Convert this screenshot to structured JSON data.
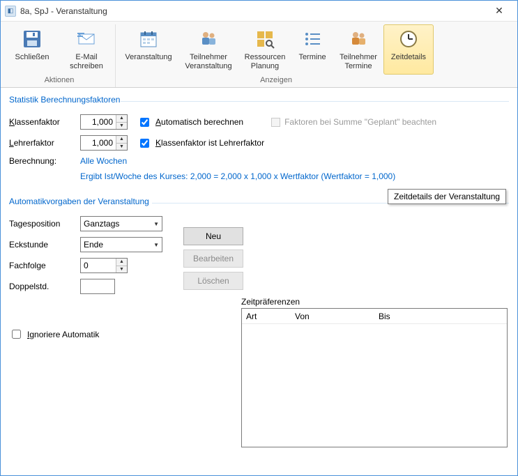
{
  "window": {
    "title": "8a, SpJ - Veranstaltung"
  },
  "ribbon": {
    "group1_label": "Aktionen",
    "group2_label": "Anzeigen",
    "btn_close": "Schließen",
    "btn_email": "E-Mail\nschreiben",
    "btn_event": "Veranstaltung",
    "btn_part_event": "Teilnehmer\nVeranstaltung",
    "btn_resources": "Ressourcen\nPlanung",
    "btn_termine": "Termine",
    "btn_part_termine": "Teilnehmer\nTermine",
    "btn_timedetails": "Zeitdetails"
  },
  "tooltip": "Zeitdetails der Veranstaltung",
  "stats": {
    "title": "Statistik Berechnungsfaktoren",
    "klassenfaktor_label": "Klassenfaktor",
    "klassenfaktor_value": "1,000",
    "lehrerfaktor_label": "Lehrerfaktor",
    "lehrerfaktor_value": "1,000",
    "auto_calc": "Automatisch berechnen",
    "k_is_l": "Klassenfaktor ist Lehrerfaktor",
    "factors_geplant": "Faktoren bei Summe \"Geplant\" beachten",
    "berechnung_label": "Berechnung:",
    "berechnung_value": "Alle Wochen",
    "berechnung_formula": "Ergibt Ist/Woche des Kurses: 2,000 = 2,000 x 1,000 x Wertfaktor (Wertfaktor = 1,000)"
  },
  "auto": {
    "title": "Automatikvorgaben der Veranstaltung",
    "tagesposition_label": "Tagesposition",
    "tagesposition_value": "Ganztags",
    "eckstunde_label": "Eckstunde",
    "eckstunde_value": "Ende",
    "fachfolge_label": "Fachfolge",
    "fachfolge_value": "0",
    "doppelstd_label": "Doppelstd.",
    "doppelstd_value": "",
    "ignore_auto": "Ignoriere Automatik",
    "btn_new": "Neu",
    "btn_edit": "Bearbeiten",
    "btn_delete": "Löschen",
    "zeitpref_title": "Zeitpräferenzen",
    "col_art": "Art",
    "col_von": "Von",
    "col_bis": "Bis"
  }
}
